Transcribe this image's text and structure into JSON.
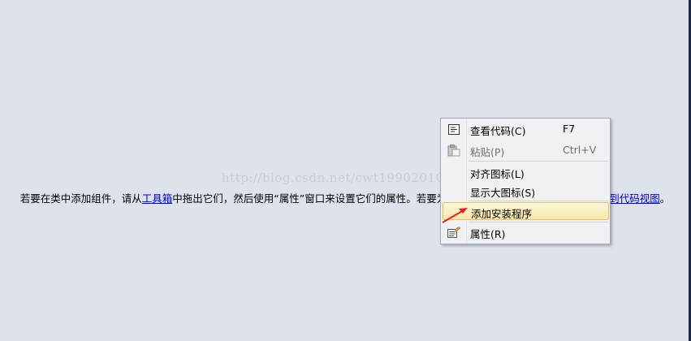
{
  "designer_message": {
    "part1": "若要在类中添加组件，请从",
    "link1": "工具箱",
    "part2": "中拖出它们，然后使用“属性”窗口来设置它们的属性。若要为类创建方法和事件，请",
    "link2": "单击此处切换到代码视图",
    "part3": "。"
  },
  "watermark": "http://blog.csdn.net/cwt19902010",
  "context_menu": {
    "items": [
      {
        "label": "查看代码(C)",
        "shortcut": "F7",
        "icon": "view-code-icon"
      },
      {
        "label": "粘贴(P)",
        "shortcut": "Ctrl+V",
        "icon": "paste-icon",
        "disabled": true
      },
      {
        "label": "对齐图标(L)"
      },
      {
        "label": "显示大图标(S)"
      },
      {
        "label": "添加安装程序"
      },
      {
        "label": "属性(R)",
        "icon": "properties-icon"
      }
    ]
  },
  "colors": {
    "background": "#dee2ea",
    "link": "#0000d0",
    "highlight": "#fbe9a9",
    "arrow": "#e02020"
  }
}
